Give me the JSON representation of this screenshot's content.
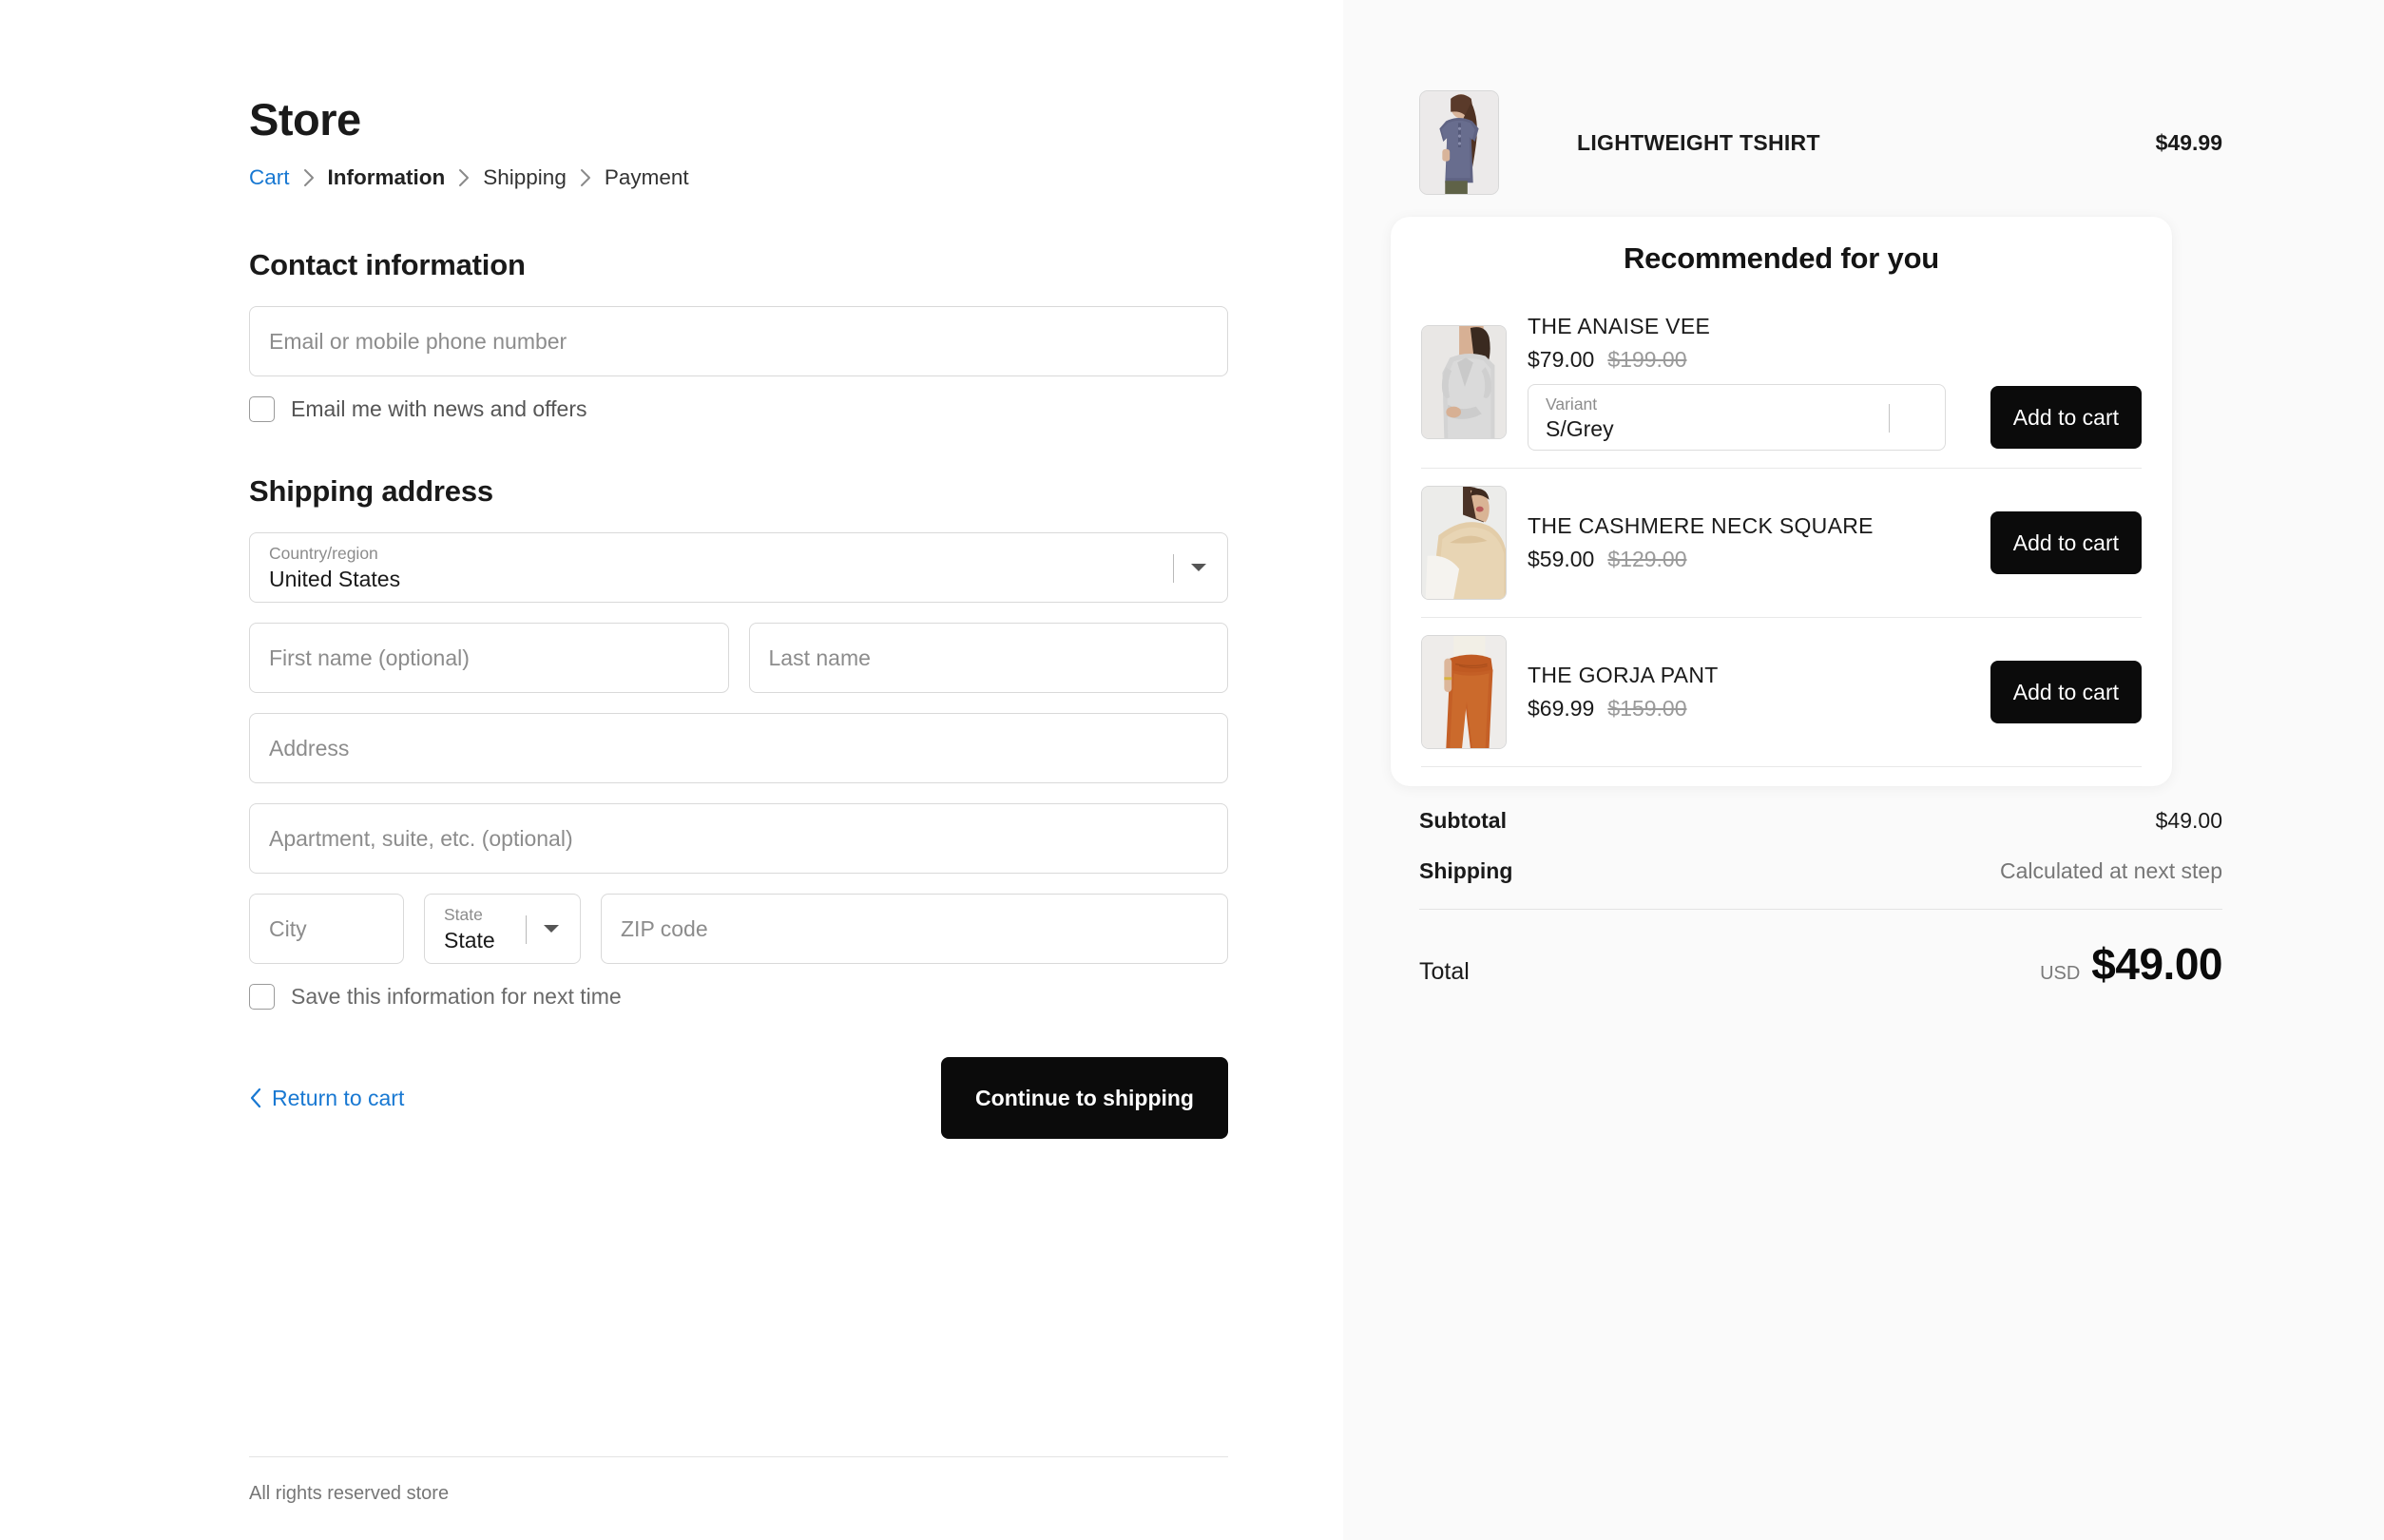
{
  "store": {
    "title": "Store",
    "footer": "All rights reserved store"
  },
  "breadcrumb": {
    "cart": "Cart",
    "information": "Information",
    "shipping": "Shipping",
    "payment": "Payment"
  },
  "contact": {
    "heading": "Contact information",
    "email_placeholder": "Email or mobile phone number",
    "email_value": "",
    "offers_checkbox_label": "Email me with news and offers"
  },
  "shipping_address": {
    "heading": "Shipping address",
    "country_label": "Country/region",
    "country_value": "United States",
    "first_name_placeholder": "First name (optional)",
    "first_name_value": "",
    "last_name_placeholder": "Last name",
    "last_name_value": "",
    "address_placeholder": "Address",
    "address_value": "",
    "apartment_placeholder": "Apartment, suite, etc. (optional)",
    "apartment_value": "",
    "city_placeholder": "City",
    "city_value": "",
    "state_label": "State",
    "state_value": "State",
    "zip_placeholder": "ZIP code",
    "zip_value": "",
    "save_checkbox_label": "Save this information for next time"
  },
  "actions": {
    "return_to_cart": "Return to cart",
    "continue": "Continue to shipping"
  },
  "summary": {
    "line_items": [
      {
        "name": "LIGHTWEIGHT TSHIRT",
        "price": "$49.99"
      }
    ],
    "subtotal_label": "Subtotal",
    "subtotal_value": "$49.00",
    "shipping_label": "Shipping",
    "shipping_value": "Calculated at next step",
    "total_label": "Total",
    "total_currency": "USD",
    "total_value": "$49.00"
  },
  "recommendations": {
    "title": "Recommended for you",
    "add_to_cart_label": "Add to cart",
    "items": [
      {
        "name": "THE ANAISE VEE",
        "price": "$79.00",
        "compare_at": "$199.00",
        "variant_label": "Variant",
        "variant_value": "S/Grey"
      },
      {
        "name": "THE CASHMERE NECK SQUARE",
        "price": "$59.00",
        "compare_at": "$129.00"
      },
      {
        "name": "THE GORJA PANT",
        "price": "$69.99",
        "compare_at": "$159.00"
      }
    ]
  },
  "colors": {
    "link": "#1878d2",
    "primary_button": "#0b0b0b",
    "sidebar_background": "#fafafa",
    "muted_text": "#767676"
  }
}
